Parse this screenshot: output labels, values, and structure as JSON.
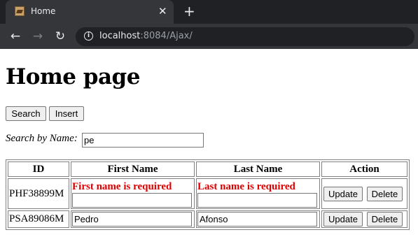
{
  "browser": {
    "tab_title": "Home",
    "close_glyph": "✕",
    "new_tab_glyph": "+",
    "back_glyph": "←",
    "forward_glyph": "→",
    "reload_glyph": "↻",
    "info_glyph": "i",
    "url_host": "localhost",
    "url_rest": ":8084/Ajax/"
  },
  "page": {
    "title": "Home page",
    "search_button": "Search",
    "insert_button": "Insert",
    "search_label": "Search by Name:",
    "search_value": "pe"
  },
  "table": {
    "headers": [
      "ID",
      "First Name",
      "Last Name",
      "Action"
    ],
    "rows": [
      {
        "id": "PHF38899M",
        "first_name_error": "First name is required",
        "first_name": "",
        "last_name_error": "Last name is required",
        "last_name": "",
        "update_label": "Update",
        "delete_label": "Delete"
      },
      {
        "id": "PSA89086M",
        "first_name": "Pedro",
        "last_name": "Afonso",
        "update_label": "Update",
        "delete_label": "Delete"
      }
    ]
  },
  "colors": {
    "error": "#e00000",
    "tabstrip": "#202124",
    "toolbar": "#35363a"
  }
}
